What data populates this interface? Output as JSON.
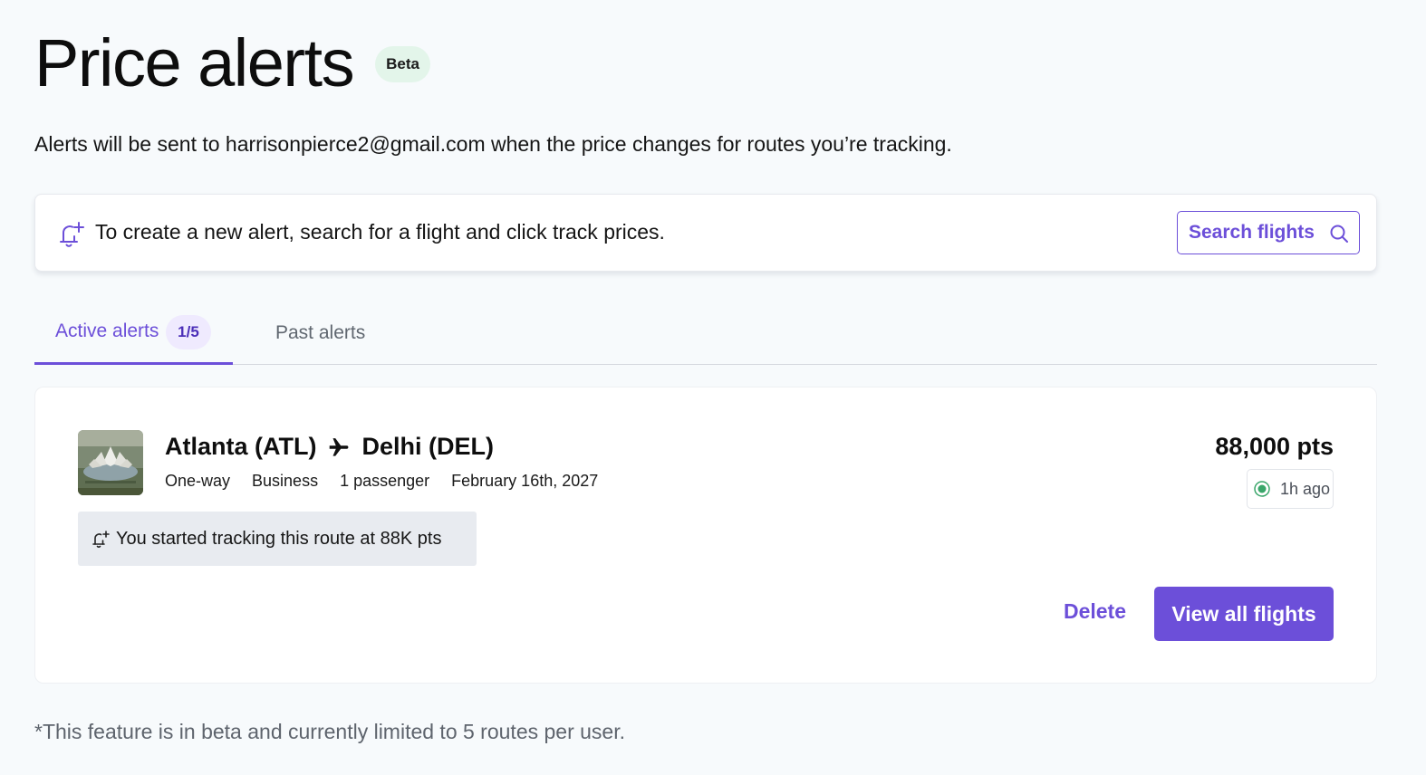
{
  "header": {
    "title": "Price alerts",
    "badge": "Beta",
    "subtitle": "Alerts will be sent to harrisonpierce2@gmail.com when the price changes for routes you’re tracking."
  },
  "info_bar": {
    "icon": "bell-plus-icon",
    "text": "To create a new alert, search for a flight and click track prices.",
    "search_button_label": "Search flights"
  },
  "tabs": {
    "active_label": "Active alerts",
    "active_count": "1/5",
    "past_label": "Past alerts"
  },
  "alerts": [
    {
      "origin": "Atlanta (ATL)",
      "destination": "Delhi (DEL)",
      "trip_type": "One-way",
      "cabin": "Business",
      "passengers": "1 passenger",
      "date": "February 16th, 2027",
      "tracking_note": "You started tracking this route at 88K pts",
      "price": "88,000 pts",
      "updated": "1h ago",
      "delete_label": "Delete",
      "view_label": "View all flights"
    }
  ],
  "footnote": "*This feature is in beta and currently limited to 5 routes per user.",
  "colors": {
    "accent": "#6c4fd9",
    "background": "#f7fafc",
    "badge_green": "#e3f5ea",
    "live_green": "#3aa66a"
  }
}
